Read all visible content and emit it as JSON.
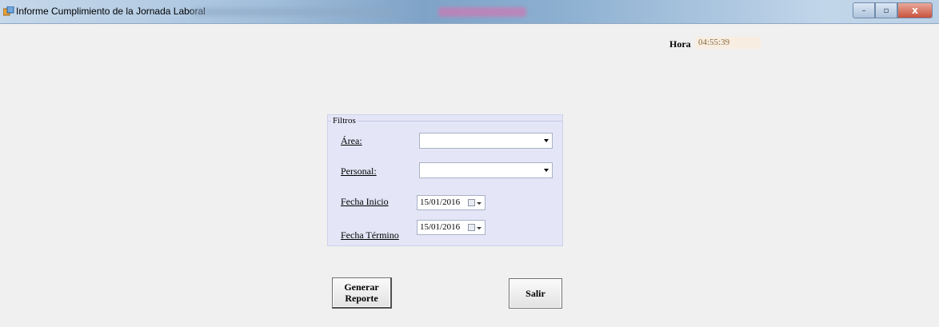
{
  "window": {
    "title": "Informe Cumplimiento de la Jornada Laboral",
    "controls": {
      "minimize": "–",
      "maximize": "▫",
      "close": "x"
    }
  },
  "clock": {
    "label": "Hora",
    "value": "04:55:39"
  },
  "filters": {
    "legend": "Filtros",
    "area": {
      "label": "Área:",
      "value": ""
    },
    "personal": {
      "label": "Personal:",
      "value": ""
    },
    "fecha_inicio": {
      "label": "Fecha Inicio",
      "value": "15/01/2016"
    },
    "fecha_termino": {
      "label": "Fecha Término",
      "value": "15/01/2016"
    }
  },
  "actions": {
    "generate_line1": "Generar",
    "generate_line2": "Reporte",
    "exit": "Salir"
  },
  "icons": {
    "app": "form-app-icon",
    "calendar": "calendar-icon",
    "dropdown": "chevron-down-icon"
  }
}
